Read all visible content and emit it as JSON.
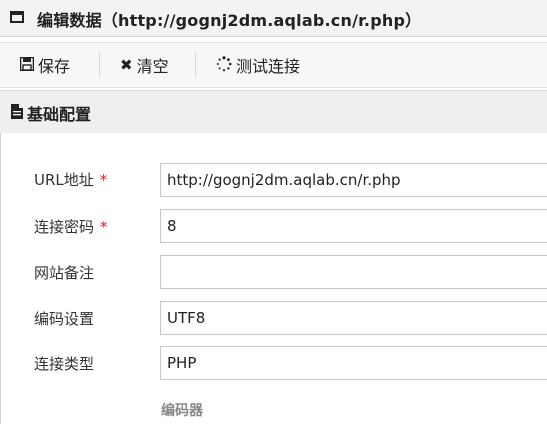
{
  "window": {
    "title": "编辑数据（http://gognj2dm.aqlab.cn/r.php）"
  },
  "toolbar": {
    "save_label": "保存",
    "clear_label": "清空",
    "test_label": "测试连接"
  },
  "section": {
    "title": "基础配置"
  },
  "form": {
    "url": {
      "label": "URL地址",
      "required_mark": "*",
      "value": "http://gognj2dm.aqlab.cn/r.php"
    },
    "password": {
      "label": "连接密码",
      "required_mark": "*",
      "value": "8"
    },
    "note": {
      "label": "网站备注",
      "value": ""
    },
    "encoding": {
      "label": "编码设置",
      "value": "UTF8"
    },
    "type": {
      "label": "连接类型",
      "value": "PHP"
    },
    "encoder_label": "编码器"
  },
  "icons": {
    "window": "window-icon",
    "save": "floppy-disk-icon",
    "clear": "x-mark-icon",
    "test": "spinner-icon",
    "section": "document-icon"
  },
  "colors": {
    "required": "#e02020"
  }
}
